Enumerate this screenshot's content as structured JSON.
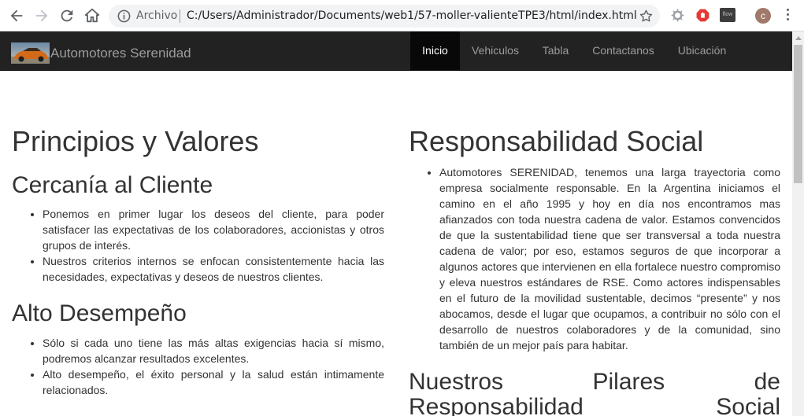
{
  "browser": {
    "scheme_label": "Archivo",
    "url": "C:/Users/Administrador/Documents/web1/57-moller-valienteTPE3/html/index.html",
    "extension_label": "flow",
    "avatar_initial": "c"
  },
  "navbar": {
    "brand": "Automotores Serenidad",
    "items": [
      {
        "label": "Inicio",
        "active": true
      },
      {
        "label": "Vehiculos",
        "active": false
      },
      {
        "label": "Tabla",
        "active": false
      },
      {
        "label": "Contactanos",
        "active": false
      },
      {
        "label": "Ubicación",
        "active": false
      }
    ]
  },
  "left": {
    "title": "Principios y Valores",
    "sections": [
      {
        "heading": "Cercanía al Cliente",
        "items": [
          "Ponemos en primer lugar los deseos del cliente, para poder satisfacer las expectativas de los colaboradores, accionistas y otros grupos de interés.",
          "Nuestros criterios internos se enfocan consistentemente hacia las necesidades, expectativas y deseos de nuestros clientes."
        ]
      },
      {
        "heading": "Alto Desempeño",
        "items": [
          "Sólo si cada uno tiene las más altas exigencias hacia sí mismo, podremos alcanzar resultados excelentes.",
          "Alto desempeño, el éxito personal y la salud están intimamente relacionados."
        ]
      }
    ]
  },
  "right": {
    "title": "Responsabilidad Social",
    "paragraph": "Automotores SERENIDAD, tenemos una larga trayectoria como empresa socialmente responsable. En la Argentina iniciamos el camino en el año 1995 y hoy en día nos encontramos mas afianzados con toda nuestra cadena de valor. Estamos convencidos de que la sustentabilidad tiene que ser transversal a toda nuestra cadena de valor; por eso, estamos seguros de que incorporar a algunos actores que intervienen en ella fortalece nuestro compromiso y eleva nuestros estándares de RSE. Como actores indispensables en el futuro de la movilidad sustentable, decimos “presente” y nos abocamos, desde el lugar que ocupamos, a contribuir no sólo con el desarrollo de nuestros colaboradores y de la comunidad, sino también de un mejor país para habitar.",
    "pillars_line1": "Nuestros Pilares de",
    "pillars_line2": "Responsabilidad Social"
  }
}
